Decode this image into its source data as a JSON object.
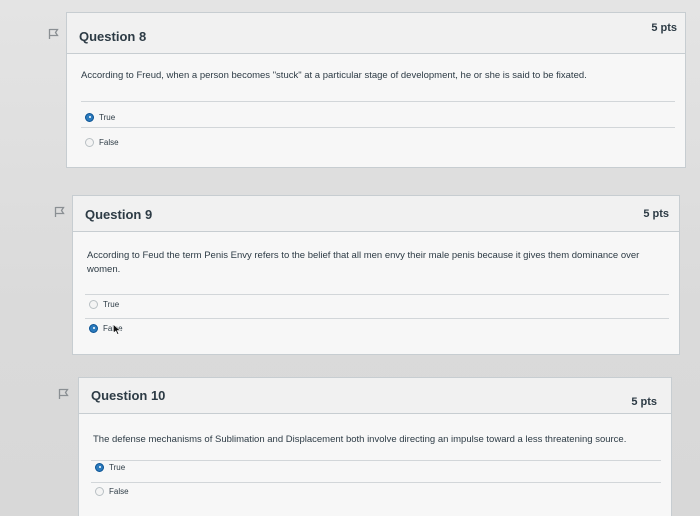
{
  "questions": [
    {
      "title": "Question 8",
      "points": "5 pts",
      "text": "According to Freud, when a person becomes \"stuck\" at a particular stage of development, he or she is said to be fixated.",
      "answers": [
        {
          "label": "True",
          "selected": true
        },
        {
          "label": "False",
          "selected": false
        }
      ]
    },
    {
      "title": "Question 9",
      "points": "5 pts",
      "text": "According to Feud the term Penis Envy refers to the belief that all men envy their male penis because it gives them dominance over women.",
      "answers": [
        {
          "label": "True",
          "selected": false
        },
        {
          "label": "False",
          "selected": true
        }
      ]
    },
    {
      "title": "Question 10",
      "points": "5 pts",
      "text": "The defense mechanisms of Sublimation and Displacement both involve directing an impulse toward a less threatening source.",
      "answers": [
        {
          "label": "True",
          "selected": true
        },
        {
          "label": "False",
          "selected": false
        }
      ]
    }
  ],
  "icons": {
    "flag": "flag-outline-icon",
    "cursor": "mouse-pointer-icon"
  },
  "colors": {
    "selected_radio": "#2b7abc",
    "border": "#c7cdd1",
    "text": "#2d3b45"
  }
}
